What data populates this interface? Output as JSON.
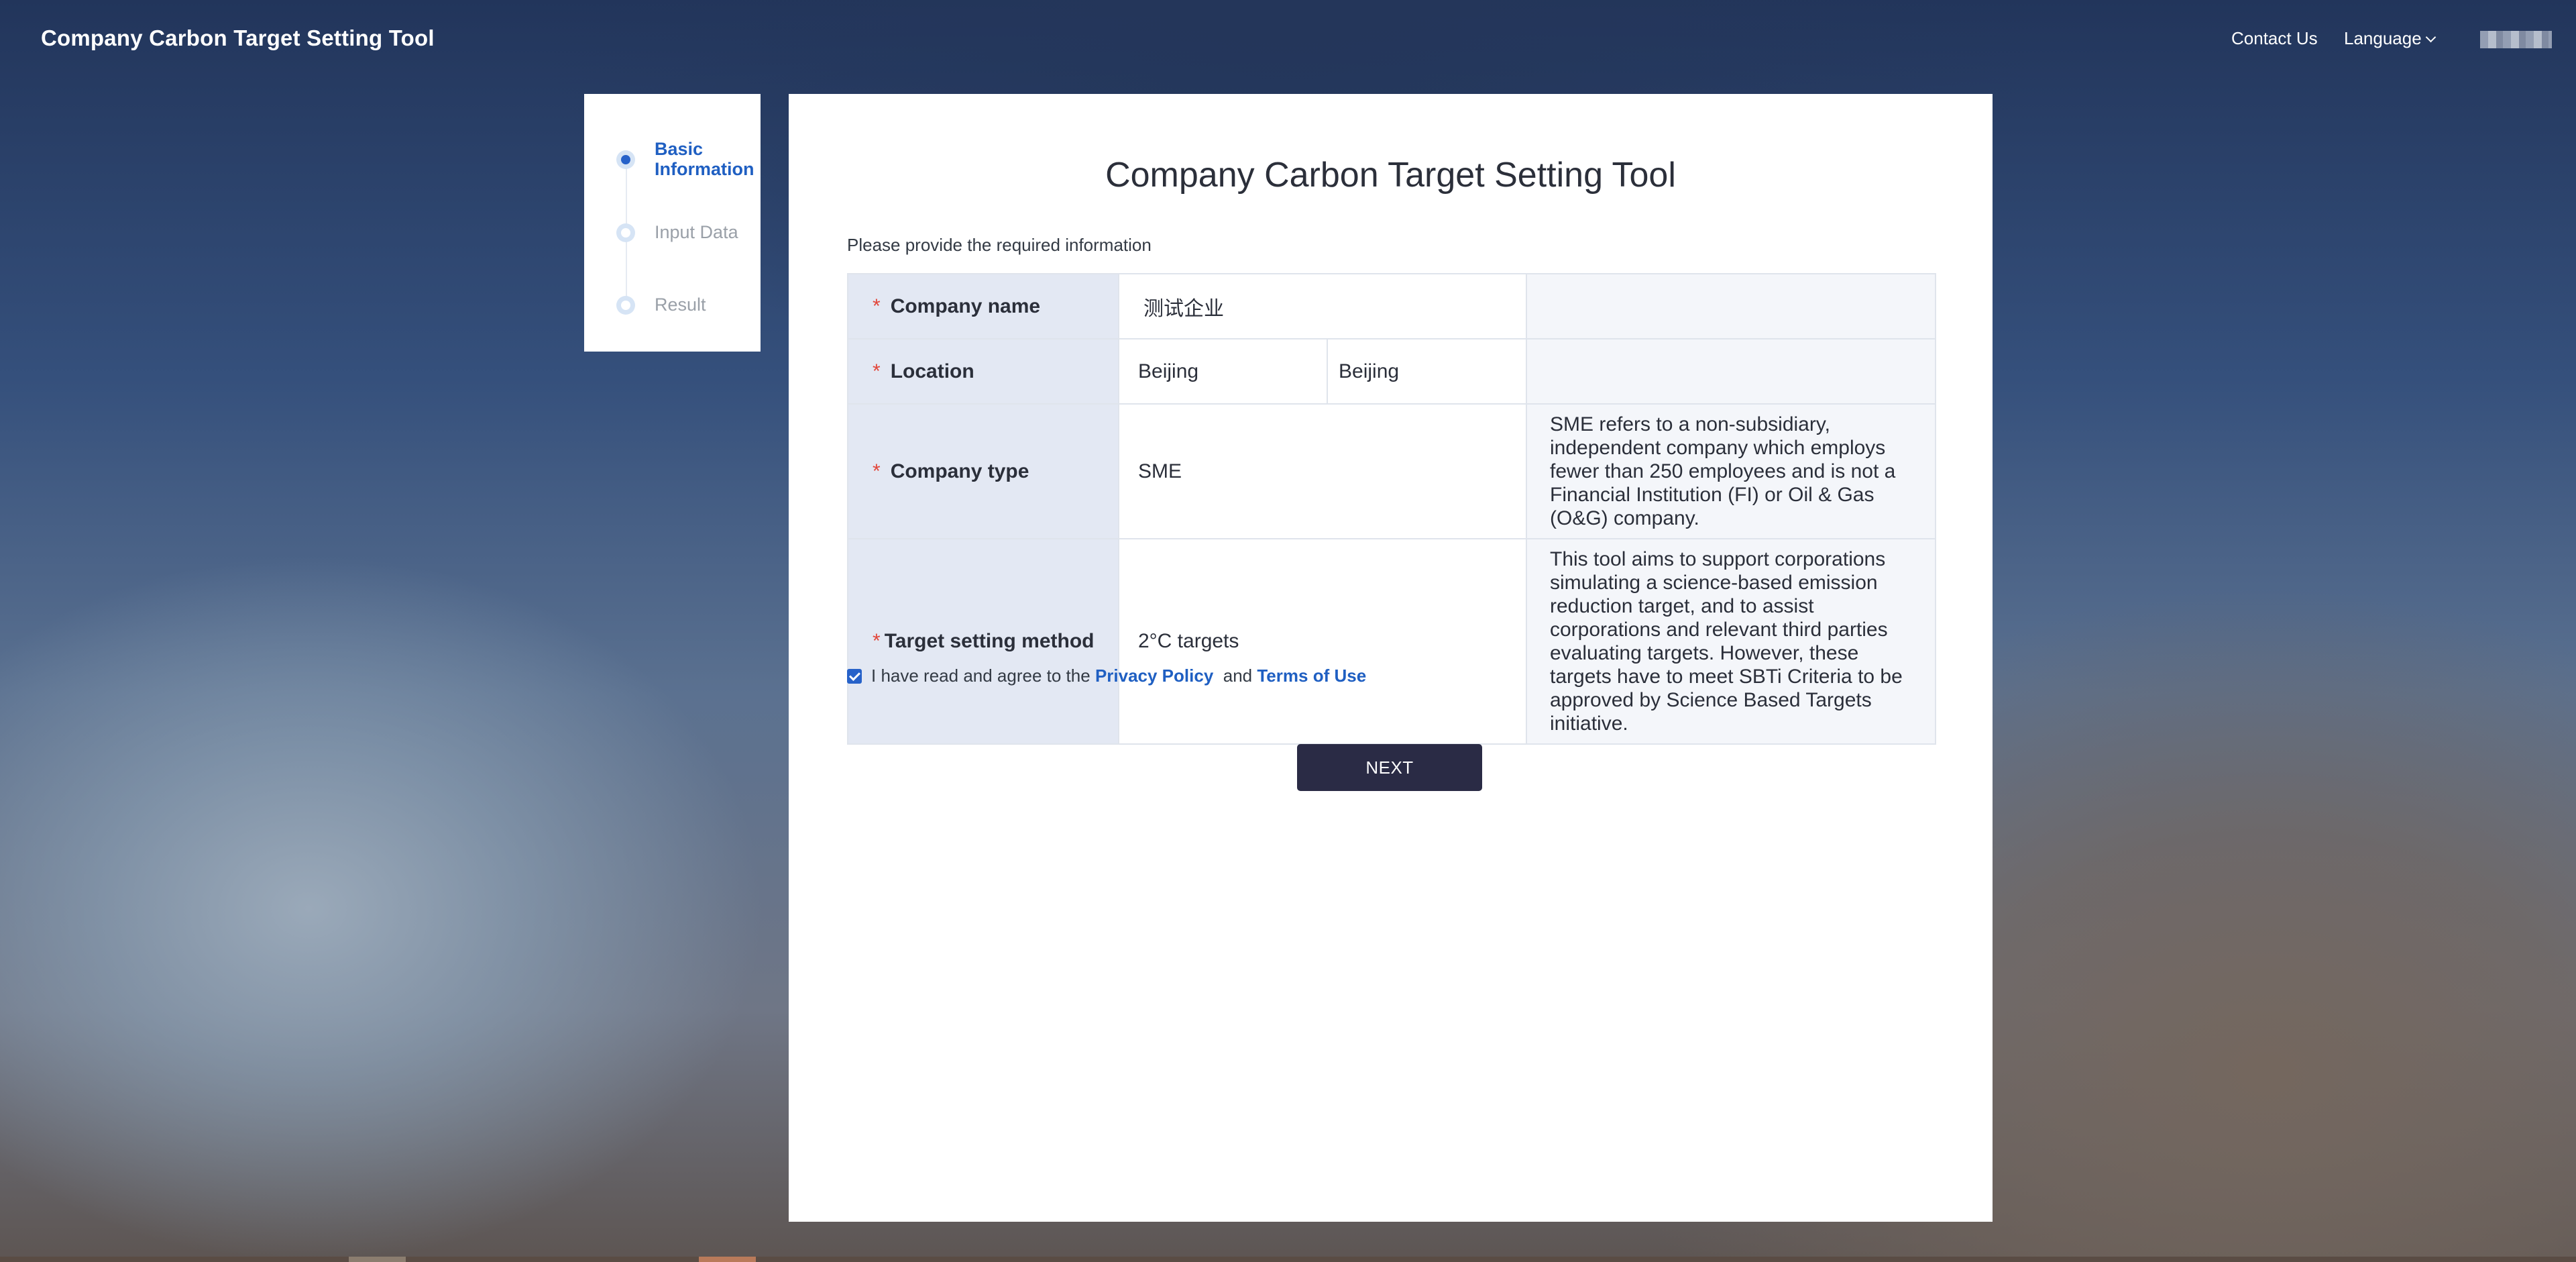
{
  "header": {
    "app_title": "Company Carbon Target Setting Tool",
    "contact_label": "Contact Us",
    "language_label": "Language"
  },
  "stepper": {
    "steps": [
      {
        "label": "Basic Information",
        "active": true
      },
      {
        "label": "Input Data",
        "active": false
      },
      {
        "label": "Result",
        "active": false
      }
    ]
  },
  "form": {
    "title": "Company Carbon Target Setting Tool",
    "subtitle": "Please provide the required information",
    "required_mark": "*",
    "rows": {
      "company_name": {
        "label": "Company name",
        "value": "测试企业",
        "note": ""
      },
      "location": {
        "label": "Location",
        "province": "Beijing",
        "city": "Beijing",
        "note": ""
      },
      "company_type": {
        "label": "Company type",
        "value": "SME",
        "note": "SME refers to a non-subsidiary, independent company which employs fewer than 250 employees and is not a Financial Institution (FI) or Oil & Gas (O&G) company."
      },
      "target_method": {
        "label": "Target setting method",
        "value": "2°C targets",
        "note": "This tool aims to support corporations simulating a science-based emission reduction target, and to assist corporations and relevant third parties evaluating targets. However, these targets have to meet SBTi Criteria to be approved by Science Based Targets initiative."
      }
    },
    "agreement": {
      "checked": true,
      "prefix": "I have read and agree to the",
      "privacy_link": "Privacy Policy",
      "and_text": "and",
      "terms_link": "Terms of Use"
    },
    "next_label": "NEXT"
  },
  "colors": {
    "accent": "#1f5fc2",
    "button": "#2a2b45",
    "label_bg": "#e3e8f3",
    "note_bg": "#f4f6fa",
    "required": "#e2463a"
  }
}
